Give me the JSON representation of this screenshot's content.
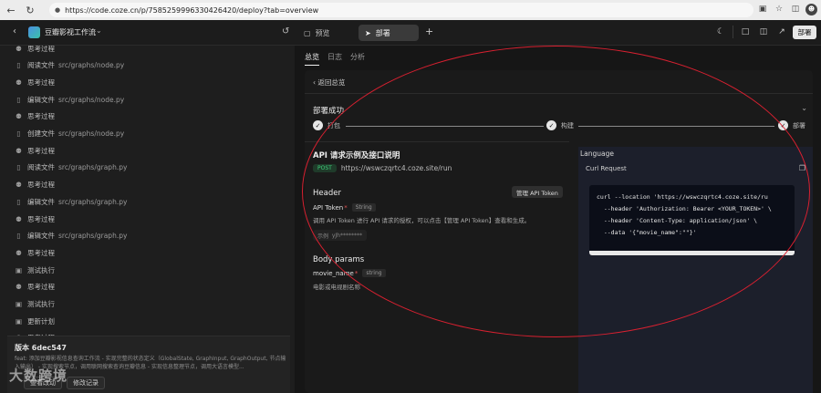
{
  "browser": {
    "url": "https://code.coze.cn/p/7585259996330426420/deploy?tab=overview"
  },
  "app": {
    "project_name": "豆瓣影视工作流",
    "tabs": [
      {
        "label": "预览"
      },
      {
        "label": "部署"
      }
    ],
    "deploy_button": "部署"
  },
  "sidebar": {
    "items": [
      {
        "type": "think",
        "label": "思考过程",
        "path": ""
      },
      {
        "type": "file",
        "label": "阅读文件",
        "path": "src/graphs/node.py"
      },
      {
        "type": "think",
        "label": "思考过程",
        "path": ""
      },
      {
        "type": "file",
        "label": "编辑文件",
        "path": "src/graphs/node.py"
      },
      {
        "type": "think",
        "label": "思考过程",
        "path": ""
      },
      {
        "type": "file",
        "label": "创建文件",
        "path": "src/graphs/node.py"
      },
      {
        "type": "think",
        "label": "思考过程",
        "path": ""
      },
      {
        "type": "file",
        "label": "阅读文件",
        "path": "src/graphs/graph.py"
      },
      {
        "type": "think",
        "label": "思考过程",
        "path": ""
      },
      {
        "type": "file",
        "label": "编辑文件",
        "path": "src/graphs/graph.py"
      },
      {
        "type": "think",
        "label": "思考过程",
        "path": ""
      },
      {
        "type": "file",
        "label": "编辑文件",
        "path": "src/graphs/graph.py"
      },
      {
        "type": "think",
        "label": "思考过程",
        "path": ""
      },
      {
        "type": "test",
        "label": "测试执行",
        "path": ""
      },
      {
        "type": "think",
        "label": "思考过程",
        "path": ""
      },
      {
        "type": "test",
        "label": "测试执行",
        "path": ""
      },
      {
        "type": "test",
        "label": "更新计划",
        "path": ""
      },
      {
        "type": "think",
        "label": "思考过程",
        "path": ""
      }
    ],
    "commit": {
      "title": "版本 6dec547",
      "description": "feat: 添加豆瓣影视信息查询工作流 - 实现完整的状态定义（GlobalState, GraphInput, GraphOutput, 节点输入输出） - 实现搜索节点，调用联网搜索查询豆瓣信息 - 实现信息整理节点，调用大语言模型...",
      "btn_view": "查看改动",
      "btn_history": "修改记录"
    },
    "watermark": "大数跨境"
  },
  "main": {
    "tabs": [
      {
        "label": "总览",
        "active": true
      },
      {
        "label": "日志",
        "active": false
      },
      {
        "label": "分析",
        "active": false
      }
    ],
    "back_label": "返回总览",
    "success_title": "部署成功",
    "steps": [
      {
        "label": "打包"
      },
      {
        "label": "构建"
      },
      {
        "label": "部署"
      }
    ],
    "api": {
      "title": "API 请求示例及接口说明",
      "method": "POST",
      "url": "https://wswczqrtc4.coze.site/run",
      "header_title": "Header",
      "manage_button": "管理 API Token",
      "token_field": "API Token",
      "token_type": "String",
      "token_desc": "调用 API Token 进行 API 请求的授权，可以点击【管理 API Token】查看和生成。",
      "example_label": "示例",
      "example_value": "yJh********",
      "body_title": "Body params",
      "body_field": "movie_name",
      "body_type": "string",
      "body_desc": "电影或电视剧名称"
    },
    "language": {
      "label": "Language",
      "request_label": "Curl Request",
      "code_lines": [
        "curl --location 'https://wswczqrtc4.coze.site/ru",
        "  --header 'Authorization: Bearer <YOUR_TOKEN>' \\",
        "  --header 'Content-Type: application/json' \\",
        "  --data '{\"movie_name\":\"\"}'"
      ]
    }
  },
  "colors": {
    "annotation": "#d82030",
    "post_badge": "#3fcf7a"
  }
}
